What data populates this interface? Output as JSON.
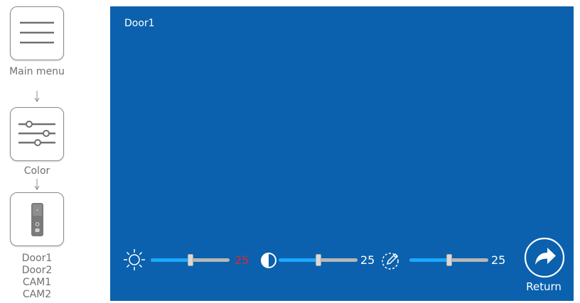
{
  "flow": {
    "main_menu_label": "Main menu",
    "color_label": "Color",
    "sources": [
      "Door1",
      "Door2",
      "CAM1",
      "CAM2"
    ]
  },
  "screen": {
    "title": "Door1",
    "controls": [
      {
        "name": "brightness",
        "icon": "sun-icon",
        "value": "25",
        "level_percent": 50,
        "value_color": "#e3262b"
      },
      {
        "name": "contrast",
        "icon": "contrast-icon",
        "value": "25",
        "level_percent": 50,
        "value_color": "#ffffff"
      },
      {
        "name": "saturation",
        "icon": "dropper-icon",
        "value": "25",
        "level_percent": 50,
        "value_color": "#ffffff"
      }
    ],
    "return_label": "Return"
  },
  "colors": {
    "screen_bg": "#0b61ad",
    "slider_fill": "#1aa8ff",
    "highlight": "#e3262b"
  }
}
